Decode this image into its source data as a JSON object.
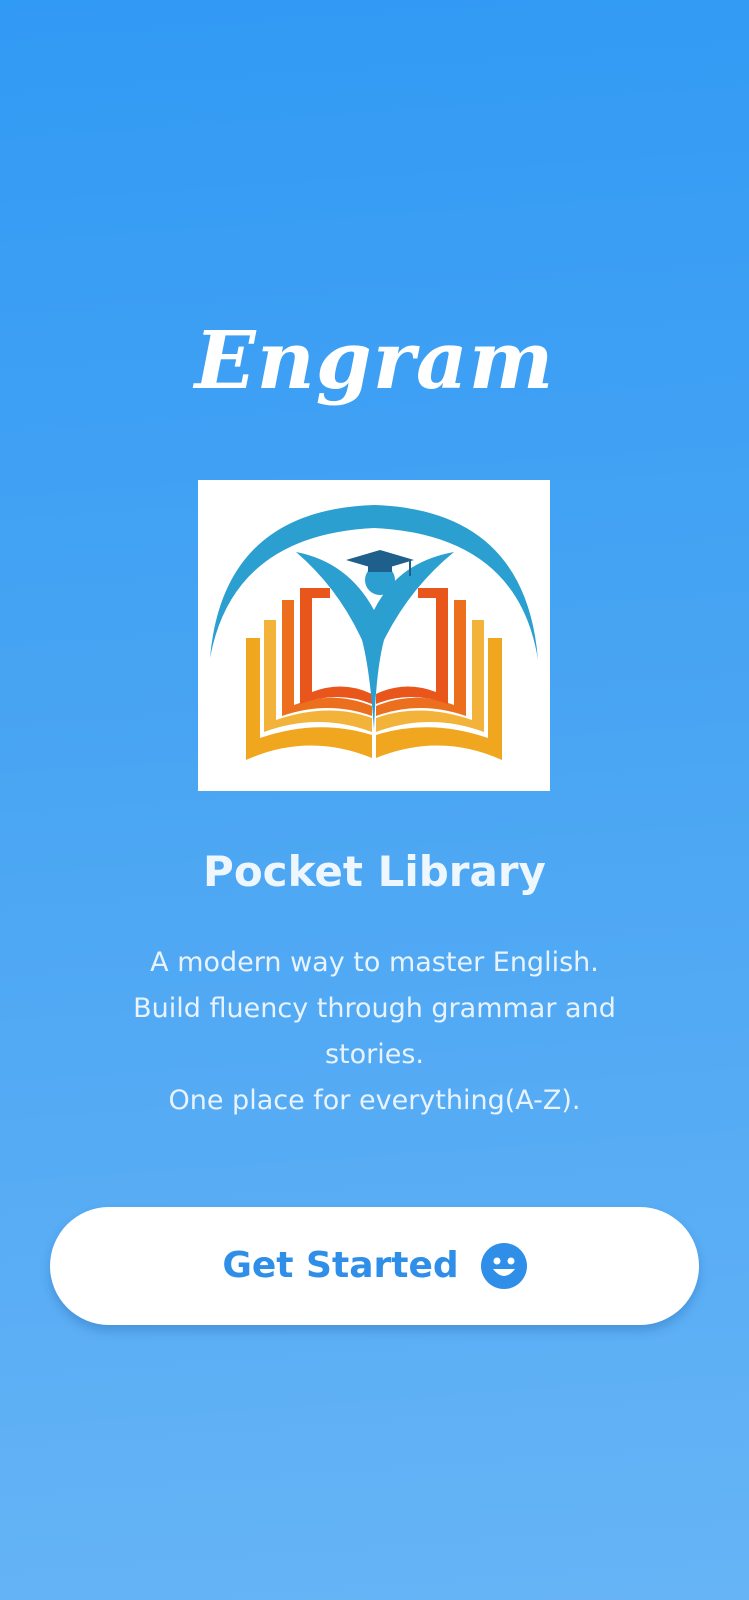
{
  "app": {
    "title": "Engram",
    "logo_icon": "book-student-logo-icon"
  },
  "main": {
    "subtitle": "Pocket Library",
    "description_lines": [
      "A modern way to master English.",
      "Build fluency through grammar and",
      "stories.",
      "One place for everything(A-Z)."
    ]
  },
  "cta": {
    "label": "Get Started",
    "icon": "smiley-icon"
  },
  "colors": {
    "background_top": "#319af4",
    "background_bottom": "#66b4f6",
    "button_text": "#2f8ee8",
    "logo_arc": "#2a9fd0",
    "logo_orange": "#e8561c",
    "logo_yellow": "#f1a61f",
    "logo_navy": "#1e5f8c"
  }
}
